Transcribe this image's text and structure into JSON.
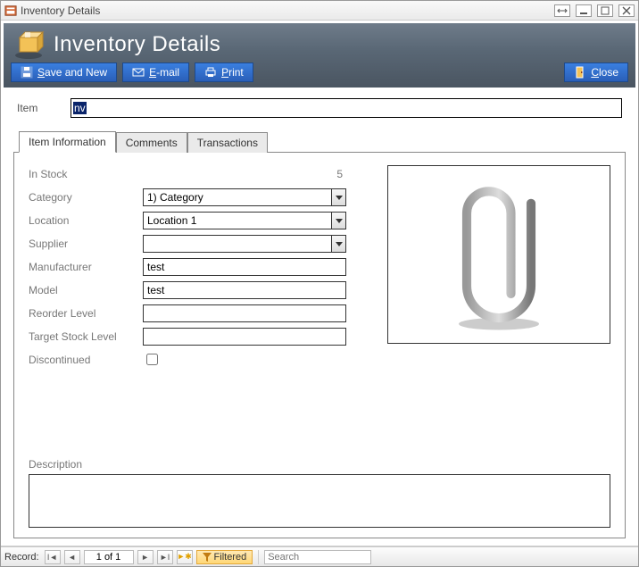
{
  "titlebar": {
    "title": "Inventory Details"
  },
  "header": {
    "heading": "Inventory Details"
  },
  "toolbar": {
    "save_new": {
      "prefix": "S",
      "rest": "ave and New"
    },
    "email": {
      "prefix": "E",
      "rest": "-mail"
    },
    "print": {
      "prefix": "P",
      "rest": "rint"
    },
    "close": {
      "prefix": "C",
      "rest": "lose"
    }
  },
  "item": {
    "label": "Item",
    "value": "nv"
  },
  "tabs": [
    {
      "label": "Item Information",
      "active": true
    },
    {
      "label": "Comments",
      "active": false
    },
    {
      "label": "Transactions",
      "active": false
    }
  ],
  "fields": {
    "in_stock": {
      "label": "In Stock",
      "value": "5"
    },
    "category": {
      "label": "Category",
      "value": "1) Category"
    },
    "location": {
      "label": "Location",
      "value": "Location 1"
    },
    "supplier": {
      "label": "Supplier",
      "value": ""
    },
    "manufacturer": {
      "label": "Manufacturer",
      "value": "test"
    },
    "model": {
      "label": "Model",
      "value": "test"
    },
    "reorder_level": {
      "label": "Reorder Level",
      "value": ""
    },
    "target_stock": {
      "label": "Target Stock Level",
      "value": ""
    },
    "discontinued": {
      "label": "Discontinued",
      "checked": false
    },
    "description": {
      "label": "Description",
      "value": ""
    }
  },
  "statusbar": {
    "record_label": "Record:",
    "position": "1 of 1",
    "filtered": "Filtered",
    "search_placeholder": "Search"
  }
}
